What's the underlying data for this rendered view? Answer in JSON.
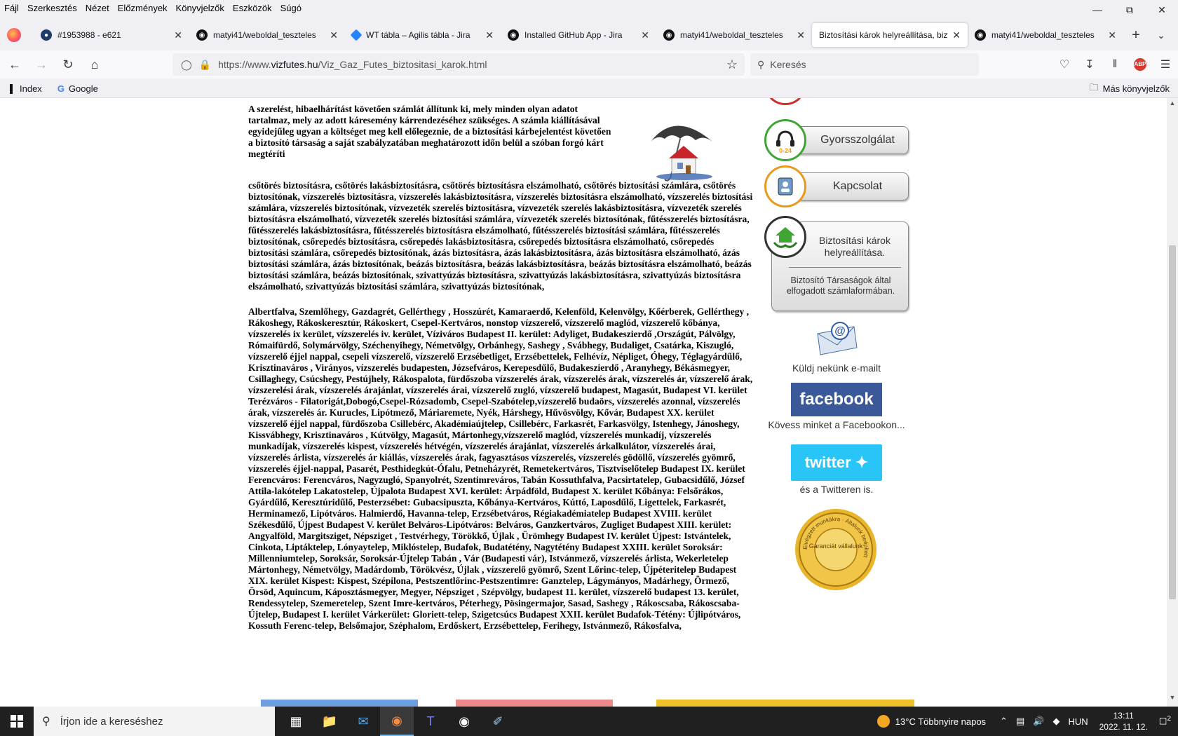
{
  "menu": [
    "Fájl",
    "Szerkesztés",
    "Nézet",
    "Előzmények",
    "Könyvjelzők",
    "Eszközök",
    "Súgó"
  ],
  "tabs": [
    {
      "label": "#1953988 - e621",
      "icon": "e621-icon",
      "color": "#1f3c67"
    },
    {
      "label": "matyi41/weboldal_teszteles",
      "icon": "github-icon",
      "color": "#111111"
    },
    {
      "label": "WT tábla – Agilis tábla - Jira",
      "icon": "jira-icon",
      "color": "#2684ff"
    },
    {
      "label": "Installed GitHub App - Jira",
      "icon": "github-icon",
      "color": "#111111"
    },
    {
      "label": "matyi41/weboldal_teszteles",
      "icon": "github-icon",
      "color": "#111111"
    },
    {
      "label": "Biztosítási károk helyreállítása, bizto",
      "icon": "none",
      "color": "#ffffff",
      "active": true
    },
    {
      "label": "matyi41/weboldal_teszteles",
      "icon": "github-icon",
      "color": "#111111"
    }
  ],
  "url": {
    "prefix": "https://www.",
    "host": "vizfutes.hu",
    "path": "/Viz_Gaz_Futes_biztositasi_karok.html"
  },
  "search": {
    "placeholder": "Keresés"
  },
  "bookmarks": {
    "index": "Index",
    "google": "Google",
    "other": "Más könyvjelzők"
  },
  "page": {
    "intro": "A szerelést, hibaelhárítást követően számlát állítunk ki, mely minden olyan adatot tartalmaz, mely az adott káresemény kárrendezéséhez szükséges. A számla kiállításával egyidejűleg ugyan a költséget meg kell előlegeznie, de a biztosítási kárbejelentést követően a biztosító társaság a saját szabályzatában meghatározott időn belül a szóban forgó kárt megtéríti",
    "keywords": "csőtörés biztosításra, csőtörés lakásbiztosításra, csőtörés biztosításra elszámolható, csőtörés biztosítási számlára, csőtörés biztosítónak, vízszerelés biztosításra, vízszerelés lakásbiztosításra, vízszerelés biztosításra elszámolható, vízszerelés biztosítási számlára, vízszerelés biztosítónak, vízvezeték szerelés biztosításra, vízvezeték szerelés lakásbiztosításra, vízvezeték szerelés biztosításra elszámolható, vízvezeték szerelés biztosítási számlára, vízvezeték szerelés biztosítónak, fűtésszerelés biztosításra, fűtésszerelés lakásbiztosításra, fűtésszerelés biztosításra elszámolható, fűtésszerelés biztosítási számlára, fűtésszerelés biztosítónak, csőrepedés biztosításra, csőrepedés lakásbiztosításra, csőrepedés biztosításra elszámolható, csőrepedés biztosítási számlára, csőrepedés biztosítónak, ázás biztosításra, ázás lakásbiztosításra, ázás biztosításra elszámolható, ázás biztosítási számlára, ázás biztosítónak, beázás biztosításra, beázás lakásbiztosításra, beázás biztosításra elszámolható, beázás biztosítási számlára, beázás biztosítónak, szivattyúzás biztosításra, szivattyúzás lakásbiztosításra, szivattyúzás biztosításra elszámolható, szivattyúzás biztosítási számlára, szivattyúzás biztosítónak,",
    "places": "Albertfalva, Szemlőhegy, Gazdagrét, Gellérthegy , Hosszúrét, Kamaraerdő, Kelenföld, Kelenvölgy, Kőérberek, Gellérthegy , Rákoshegy, Rákoskeresztúr, Rákoskert, Csepel-Kertváros, nonstop vízszerelő, vízszerelő maglód, vízszerelő kőbánya, vízszerelés ix kerület, vízszerelés iv. kerület, Víziváros Budapest II. kerület: Adyliget, Budakeszierdő ,Országút, Pálvölgy, Rómaifürdő, Solymárvölgy, Széchenyihegy, Németvölgy, Orbánhegy, Sashegy , Svábhegy, Budaliget, Csatárka, Kiszugló, vízszerelő éjjel nappal, csepeli vízszerelő, vízszerelő Erzsébetliget, Erzsébettelek, Felhévíz, Népliget, Óhegy, Téglagyárdűlő, Krisztinaváros , Virányos, vízszerelés budapesten, Józsefváros, Kerepesdűlő, Budakeszierdő , Aranyhegy, Békásmegyer, Csillaghegy, Csúcshegy, Pestújhely, Rákospalota, fürdőszoba vízszerelés árak, vízszerelés árak, vízszerelés ár, vízszerelő árak, vízszerelési árak, vízszerelés árajánlat, vízszerelés árai, vízszerelő zugló, vízszerelő budapest, Magasút, Budapest VI. kerület Terézváros - Filatorigát,Dobogó,Csepel-Rózsadomb, Csepel-Szabótelep,vízszerelő budaörs, vízszerelés azonnal, vízszerelés árak, vízszerelés ár. Kurucles, Lipótmező, Máriaremete, Nyék, Hárshegy, Hűvösvölgy, Kővár, Budapest XX. kerület vízszerelő éjjel nappal, fürdőszoba Csillebérc, Akadémiaújtelep, Csillebérc, Farkasrét, Farkasvölgy, Istenhegy, Jánoshegy, Kissvábhegy, Krisztinaváros , Kútvölgy, Magasút, Mártonhegy,vízszerelő maglód, vízszerelés munkadíj, vízszerelés munkadíjak, vízszerelés kispest, vízszerelés hétvégén, vízszerelés árajánlat, vízszerelés árkalkulátor, vízszerelés árai, vízszerelés árlista, vízszerelés ár kiállás, vízszerelés árak, fagyasztásos vízszerelés, vízszerelés gödöllő, vízszerelés gyömrő, vízszerelés éjjel-nappal, Pasarét, Pesthidegkút-Ófalu, Petneházyrét, Remetekertváros, Tisztviselőtelep Budapest IX. kerület Ferencváros: Ferencváros, Nagyzugló, Spanyolrét, Szentimreváros, Tabán Kossuthfalva, Pacsirtatelep, Gubacsidűlő, József Attila-lakótelep Lakatostelep, Újpalota Budapest XVI. kerület: Árpádföld, Budapest X. kerület Kőbánya: Felsőrákos, Gyárdűlő, Keresztúridűlő, Pesterzsébet: Gubacsipuszta, Kőbánya-Kertváros, Kúttó, Laposdűlő, Ligettelek, Farkasrét, Herminamező, Lipótváros. Halmierdő, Havanna-telep, Erzsébetváros, Régiakadémiatelep Budapest XVIII. kerület Székesdűlő, Újpest Budapest V. kerület Belváros-Lipótváros: Belváros, Ganzkertváros, Zugliget Budapest XIII. kerület: Angyalföld, Margitsziget, Népsziget , Testvérhegy, Törökkő, Újlak , Ürömhegy Budapest IV. kerület Újpest: Istvántelek, Cinkota, Liptáktelep, Lónyaytelep, Miklóstelep, Budafok, Budatétény, Nagytétény Budapest XXIII. kerület Soroksár: Millenniumtelep, Soroksár, Soroksár-Újtelep Tabán , Vár (Budapesti vár), Istvánmező, vízszerelés árlista, Wekerletelep Mártonhegy, Németvölgy, Madárdomb, Törökvész, Újlak , vízszerelő gyömrő, Szent Lőrinc-telep, Újpéteritelep Budapest XIX. kerület Kispest: Kispest, Szépilona, Pestszentlőrinc-Pestszentimre: Ganztelep, Lágymányos, Madárhegy, Örmező, Örsöd, Aquincum, Káposztásmegyer, Megyer, Népsziget , Szépvölgy, budapest 11. kerület, vízszerelő budapest 13. kerület, Rendessytelep, Szemeretelep, Szent Imre-kertváros, Péterhegy, Pösingermajor, Sasad, Sashegy , Rákoscsaba, Rákoscsaba-Újtelep, Budapest I. kerület Várkerület: Gloriett-telep, Szigetcsúcs Budapest XXII. kerület Budafok-Tétény: Újlipótváros, Kossuth Ferenc-telep, Belsőmajor, Széphalom, Erdőskert, Erzsébettelep, Ferihegy, Istvánmező, Rákosfalva,"
  },
  "sidebar": {
    "gyors": "Gyorsszolgálat",
    "gyors_badge": "0-24",
    "kapcsolat": "Kapcsolat",
    "biz_title": "Biztosítási károk helyreállítása.",
    "biz_sub": "Biztosító Társaságok által elfogadott számlaformában.",
    "email_caption": "Küldj nekünk e-mailt",
    "fb_label": "facebook",
    "fb_caption": "Kövess minket a Facebookon...",
    "tw_label": "twitter",
    "tw_caption": "és a Twitteren is.",
    "badge_center": "Garanciát vállalunk",
    "badge_ring": "Elvégzett munkákra · Általunk beépített"
  },
  "colors": {
    "accent_green": "#3fa535",
    "fb": "#3b5998",
    "tw": "#29c5f6",
    "gold": "#e9b52a"
  },
  "taskbar": {
    "search_placeholder": "Írjon ide a kereséshez",
    "weather": "13°C  Többnyire napos",
    "lang": "HUN",
    "time": "13:11",
    "date": "2022. 11. 12.",
    "notif": "2"
  }
}
